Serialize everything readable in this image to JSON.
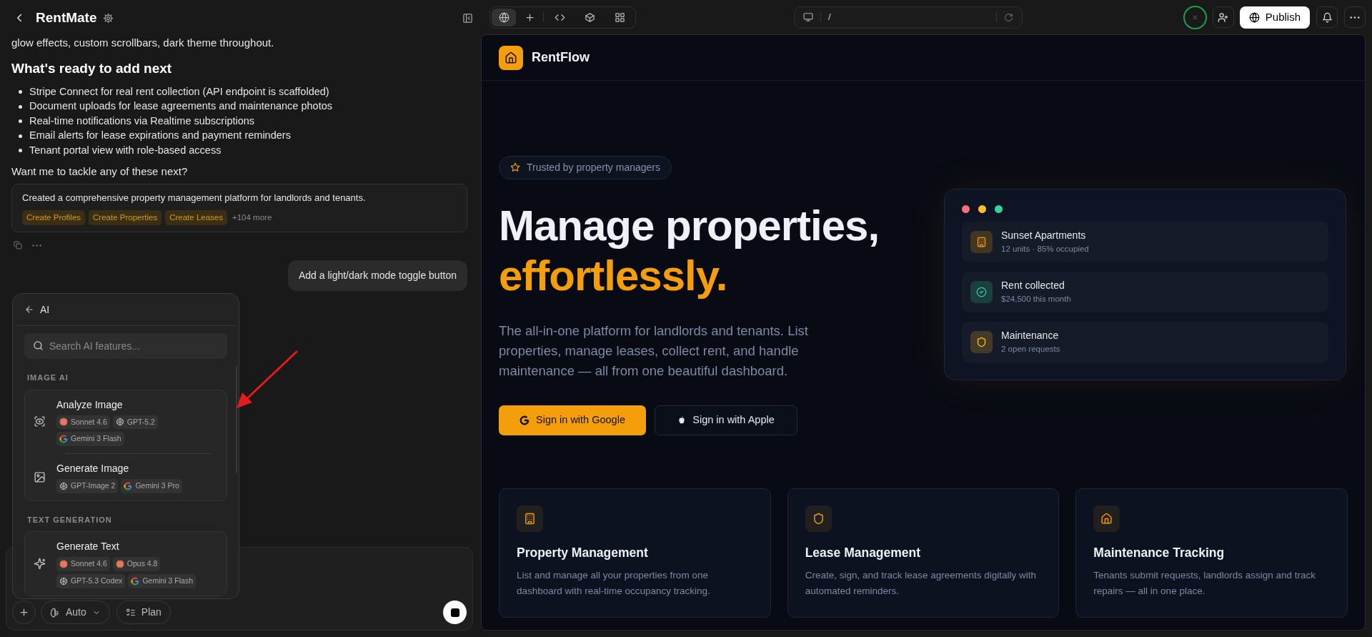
{
  "project": {
    "title": "RentMate"
  },
  "chat": {
    "intro_tail": "glow effects, custom scrollbars, dark theme throughout.",
    "heading": "What's ready to add next",
    "bullets": [
      "Stripe Connect for real rent collection (API endpoint is scaffolded)",
      "Document uploads for lease agreements and maintenance photos",
      "Real-time notifications via Realtime subscriptions",
      "Email alerts for lease expirations and payment reminders",
      "Tenant portal view with role-based access"
    ],
    "question": "Want me to tackle any of these next?",
    "summary_card": {
      "text": "Created a comprehensive property management platform for landlords and tenants.",
      "tags": [
        "Create Profiles",
        "Create Properties",
        "Create Leases"
      ],
      "more": "+104 more"
    },
    "user_message": "Add a light/dark mode toggle button"
  },
  "ai_menu": {
    "title": "AI",
    "search_placeholder": "Search AI features...",
    "sections": [
      {
        "label": "IMAGE AI",
        "items": [
          {
            "title": "Analyze Image",
            "models": [
              "Sonnet 4.6",
              "GPT-5.2",
              "Gemini 3 Flash"
            ]
          },
          {
            "title": "Generate Image",
            "models": [
              "GPT-Image 2",
              "Gemini 3 Pro"
            ]
          }
        ]
      },
      {
        "label": "TEXT GENERATION",
        "items": [
          {
            "title": "Generate Text",
            "models": [
              "Sonnet 4.6",
              "Opus 4.8",
              "GPT-5.3 Codex",
              "Gemini 3 Flash"
            ]
          }
        ]
      }
    ]
  },
  "composer": {
    "mode": "Auto",
    "plan": "Plan"
  },
  "toolbar": {
    "url": "/",
    "publish": "Publish"
  },
  "preview": {
    "brand": "RentFlow",
    "badge": "Trusted by property managers",
    "headline": "Manage properties,",
    "headline_accent": "effortlessly.",
    "description": "The all-in-one platform for landlords and tenants. List properties, manage leases, collect rent, and handle maintenance — all from one beautiful dashboard.",
    "buttons": [
      {
        "label": "Sign in with Google",
        "kind": "google"
      },
      {
        "label": "Sign in with Apple",
        "kind": "apple"
      }
    ],
    "stats": [
      {
        "title": "Sunset Apartments",
        "subtitle": "12 units · 85% occupied",
        "color": "#f59e0b"
      },
      {
        "title": "Rent collected",
        "subtitle": "$24,500 this month",
        "color": "#34d399"
      },
      {
        "title": "Maintenance",
        "subtitle": "2 open requests",
        "color": "#fbbf24"
      }
    ],
    "features": [
      {
        "title": "Property Management",
        "text": "List and manage all your properties from one dashboard with real-time occupancy tracking."
      },
      {
        "title": "Lease Management",
        "text": "Create, sign, and track lease agreements digitally with automated reminders."
      },
      {
        "title": "Maintenance Tracking",
        "text": "Tenants submit requests, landlords assign and track repairs — all in one place."
      }
    ]
  }
}
